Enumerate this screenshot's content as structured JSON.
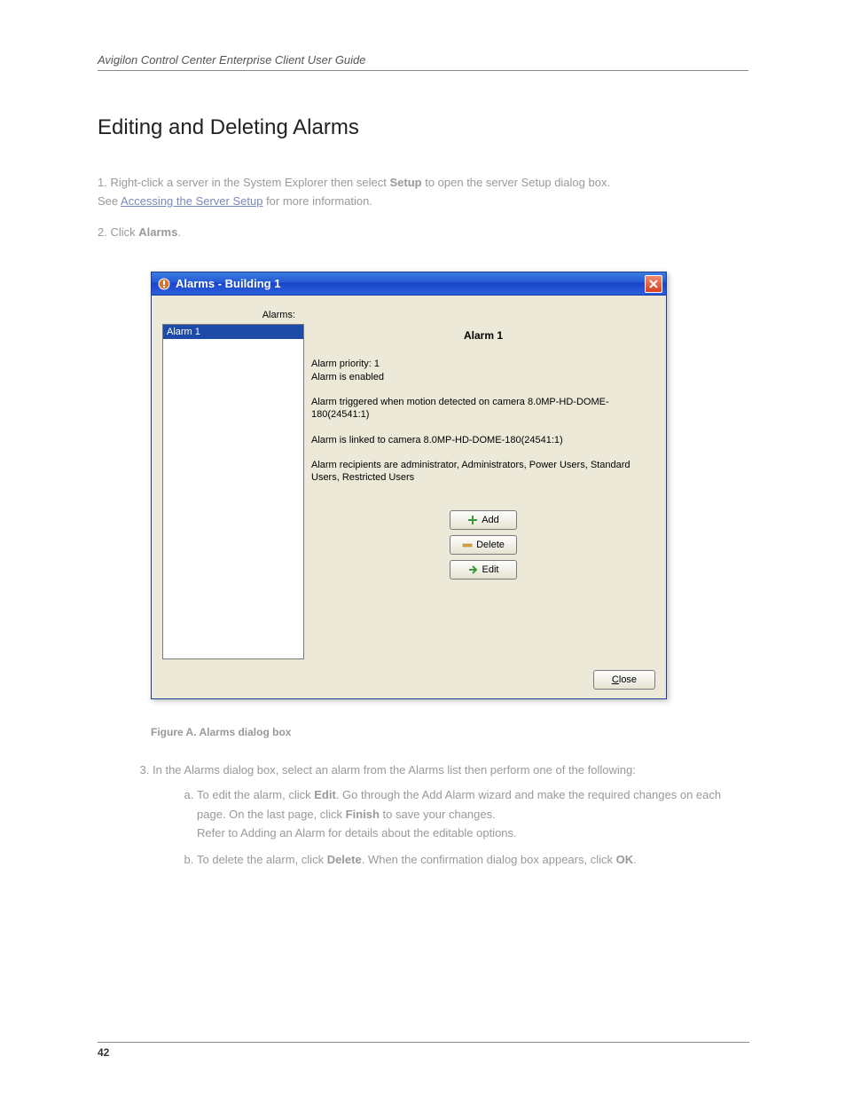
{
  "header": {
    "text": "Avigilon Control Center Enterprise Client User Guide"
  },
  "section": {
    "title": "Editing and Deleting Alarms"
  },
  "intro": {
    "p1_a": "1. Right-click a server in the System Explorer then select ",
    "p1_b": "Setup",
    "p1_c": " to open the server Setup dialog box.",
    "p1_d": "See ",
    "p1_link": "Accessing the Server Setup",
    "p1_e": " for more information.",
    "p2_a": "2. Click ",
    "p2_b": "Alarms",
    "p2_c": "."
  },
  "dialog": {
    "title": "Alarms - Building 1",
    "alarms_label": "Alarms:",
    "list": {
      "item1": "Alarm 1"
    },
    "detail_title": "Alarm 1",
    "priority": "Alarm priority: 1",
    "enabled": "Alarm is enabled",
    "trigger": "Alarm triggered when motion detected on camera 8.0MP-HD-DOME-180(24541:1)",
    "linked": "Alarm is linked to camera 8.0MP-HD-DOME-180(24541:1)",
    "recipients": "Alarm recipients are administrator, Administrators, Power Users, Standard Users, Restricted Users",
    "add_btn": "Add",
    "delete_btn": "Delete",
    "edit_btn": "Edit",
    "close_btn_u": "C",
    "close_btn_rest": "lose"
  },
  "figure": {
    "caption": "Figure A. Alarms dialog box"
  },
  "steps": {
    "s3": "In the Alarms dialog box, select an alarm from the Alarms list then perform one of the following:",
    "s3a_a": "To edit the alarm, click ",
    "s3a_b": "Edit",
    "s3a_c": ". Go through the Add Alarm wizard and make the required changes on each page. On the last page, click ",
    "s3a_d": "Finish",
    "s3a_e": " to save your changes.",
    "s3a_f": "Refer to ",
    "s3a_link": "Adding an Alarm",
    "s3a_g": " for details about the editable options.",
    "s3b_a": "To delete the alarm, click ",
    "s3b_b": "Delete",
    "s3b_c": ". When the confirmation dialog box appears, click ",
    "s3b_d": "OK",
    "s3b_e": "."
  },
  "page_number": "42"
}
